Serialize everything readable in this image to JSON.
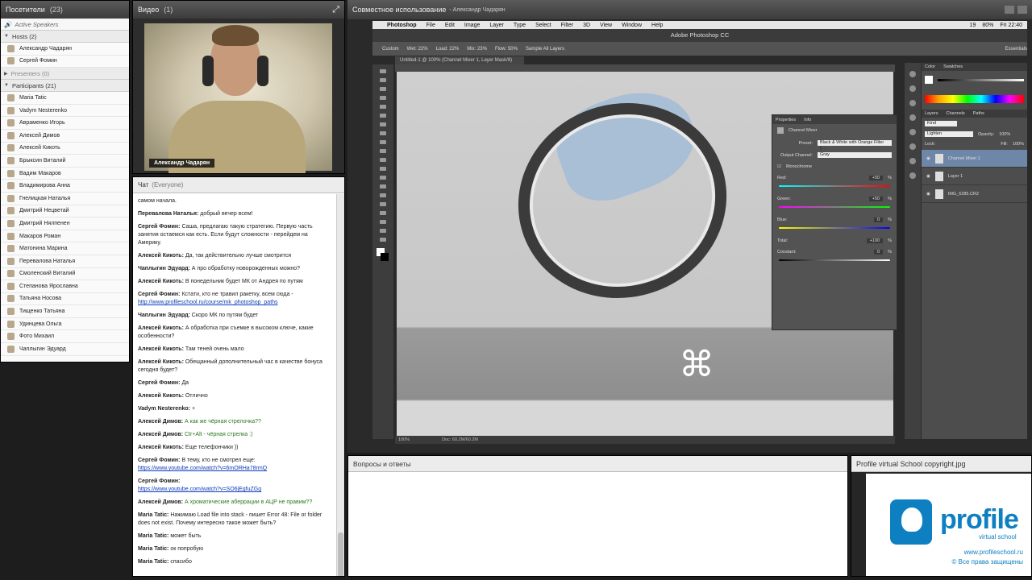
{
  "attendees": {
    "title": "Посетители",
    "count": "(23)",
    "active_speakers": "Active Speakers",
    "hosts_label": "Hosts (2)",
    "hosts": [
      "Александр Чадарян",
      "Сергей Фомин"
    ],
    "presenters_label": "Presenters (0)",
    "participants_label": "Participants (21)",
    "participants": [
      "Maria Tatic",
      "Vadym Nesterenko",
      "Авраменко Игорь",
      "Алексей Димов",
      "Алексей Кикоть",
      "Брыксин Виталий",
      "Вадим Макаров",
      "Владимирова Анна",
      "Гнелицкая Наталья",
      "Дмитрий Нецветай",
      "Дмитрий Нялпенен",
      "Макаров Роман",
      "Матонина Марина",
      "Перевалова Наталья",
      "Смоленский Виталий",
      "Степанова Ярославна",
      "Татьяна Носова",
      "Тищенко Татьяна",
      "Удинцева Ольга",
      "Фото Михаил",
      "Чаплыгин Эдуард"
    ]
  },
  "video": {
    "title": "Видео",
    "count": "(1)",
    "speaker": "Александр Чадарян"
  },
  "chat": {
    "title": "Чат",
    "audience": "(Everyone)",
    "messages": [
      {
        "who": "",
        "text": "самом начала."
      },
      {
        "who": "Перевалова Наталья:",
        "text": "добрый вечер всем!"
      },
      {
        "who": "Сергей Фомин:",
        "text": "Саша, предлагаю такую стратегию. Первую часть занятия остаемся как есть. Если будут сложности - перейдем на Америку."
      },
      {
        "who": "Алексей Кикоть:",
        "text": "Да, так действительно лучше смотрится"
      },
      {
        "who": "Чаплыгин Эдуард:",
        "text": "А про обработку новорожденных можно?"
      },
      {
        "who": "Алексей Кикоть:",
        "text": "В понедельник будет МК от Андрея по путям"
      },
      {
        "who": "Сергей Фомин:",
        "text": "Кстати, кто не травил ракетку, всем сюда -",
        "link": "http://www.profileschool.ru/course/mk_photoshop_paths"
      },
      {
        "who": "Чаплыгин Эдуард:",
        "text": "Скоро МК по путям будет"
      },
      {
        "who": "Алексей Кикоть:",
        "text": "А обработка при съемке в высоком ключе, какие особенности?"
      },
      {
        "who": "Алексей Кикоть:",
        "text": "Там теней очень мало"
      },
      {
        "who": "Алексей Кикоть:",
        "text": "Обещанный дополнительный час в качестве бонуса сегодня будет?"
      },
      {
        "who": "Сергей Фомин:",
        "text": "Да"
      },
      {
        "who": "Алексей Кикоть:",
        "text": "Отлично"
      },
      {
        "who": "Vadym Nesterenko:",
        "text": "+"
      },
      {
        "who": "Алексей Димов:",
        "text": "А как же чёрная стрелочка??",
        "green": true
      },
      {
        "who": "Алексей Димов:",
        "text": "Ctr+Alt - чёрная стрелка :)",
        "green": true
      },
      {
        "who": "Алексей Кикоть:",
        "text": "Еще телефончики ))"
      },
      {
        "who": "Сергей Фомин:",
        "text": "В тему, кто не смотрел еще:",
        "link": "https://www.youtube.com/watch?v=6mORHa78rmQ"
      },
      {
        "who": "Сергей Фомин:",
        "text": "",
        "link": "https://www.youtube.com/watch?v=SO6jEgfuZGg"
      },
      {
        "who": "Алексей Димов:",
        "text": "А хроматические аберрации в АЦР не правим??",
        "green": true
      },
      {
        "who": "Maria Tatic:",
        "text": "Нажимаю Load  file into stack - пишет Error 48: File or folder does not exist. Почему интересно такое может быть?"
      },
      {
        "who": "Maria Tatic:",
        "text": "может быть"
      },
      {
        "who": "Maria Tatic:",
        "text": "ок попробую"
      },
      {
        "who": "Maria Tatic:",
        "text": "спасибо"
      }
    ]
  },
  "share": {
    "title": "Совместное использование",
    "presenter": "- Александр Чадарян",
    "mac_menu": [
      "Photoshop",
      "File",
      "Edit",
      "Image",
      "Layer",
      "Type",
      "Select",
      "Filter",
      "3D",
      "View",
      "Window",
      "Help"
    ],
    "mac_right": [
      "19",
      "80%",
      "Fri 22:40"
    ],
    "app_title": "Adobe Photoshop CC",
    "options": [
      "Custom",
      "Wet: 22%",
      "Load: 22%",
      "Mix: 23%",
      "Flow: 50%",
      "Sample All Layers",
      "Essentials"
    ],
    "doc_tab": "Untitled-1 @ 100% (Channel Mixer 1, Layer Mask/8)",
    "status_zoom": "100%",
    "status_doc": "Doc: 60.2M/60.2M",
    "shortcut_glyph": "⌘",
    "properties": {
      "tabs": [
        "Properties",
        "Info"
      ],
      "name": "Channel Mixer",
      "preset_label": "Preset:",
      "preset": "Black & White with Orange Filter (...",
      "output_label": "Output Channel:",
      "output": "Gray",
      "monochrome": "Monochrome",
      "channels": [
        {
          "label": "Red:",
          "value": "+50",
          "unit": "%"
        },
        {
          "label": "Green:",
          "value": "+50",
          "unit": "%"
        },
        {
          "label": "Blue:",
          "value": "0",
          "unit": "%"
        },
        {
          "label": "Total:",
          "value": "+100",
          "unit": "%"
        },
        {
          "label": "Constant:",
          "value": "0",
          "unit": "%"
        }
      ]
    },
    "right_panel": {
      "color_tabs": [
        "Color",
        "Swatches"
      ],
      "layer_tabs": [
        "Layers",
        "Channels",
        "Paths"
      ],
      "kind": "Kind",
      "blend": "Lighten",
      "opacity_label": "Opacity:",
      "opacity": "100%",
      "lock_label": "Lock:",
      "fill_label": "Fill:",
      "fill": "100%",
      "layers": [
        "Channel Mixer 1",
        "Layer 1",
        "IMG_6285.CR2"
      ]
    }
  },
  "qa": {
    "title": "Вопросы и ответы"
  },
  "logo_pod": {
    "title": "Profile virtual School copyright.jpg",
    "brand": "profile",
    "tagline": "virtual school",
    "site": "www.profileschool.ru",
    "rights": "© Все права защищены"
  }
}
